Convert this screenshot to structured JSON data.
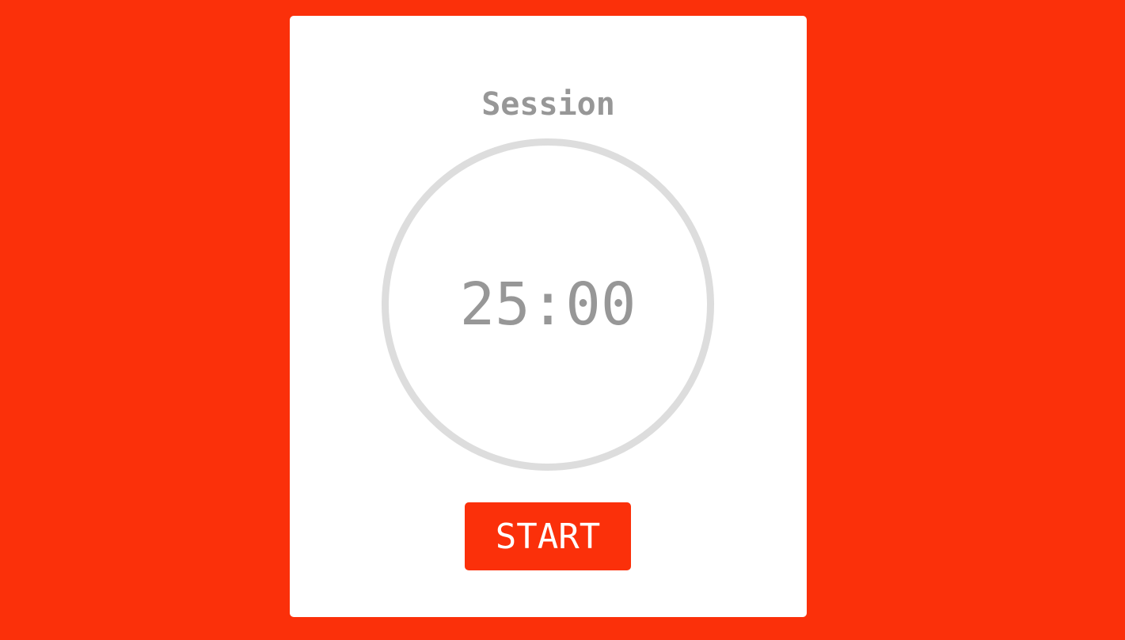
{
  "session": {
    "title": "Session",
    "time": "25:00"
  },
  "controls": {
    "start_label": "START"
  },
  "colors": {
    "background": "#fb300a",
    "card": "#ffffff",
    "text": "#979797",
    "ring": "#dddddd",
    "button": "#fb300a",
    "button_text": "#ffffff"
  }
}
